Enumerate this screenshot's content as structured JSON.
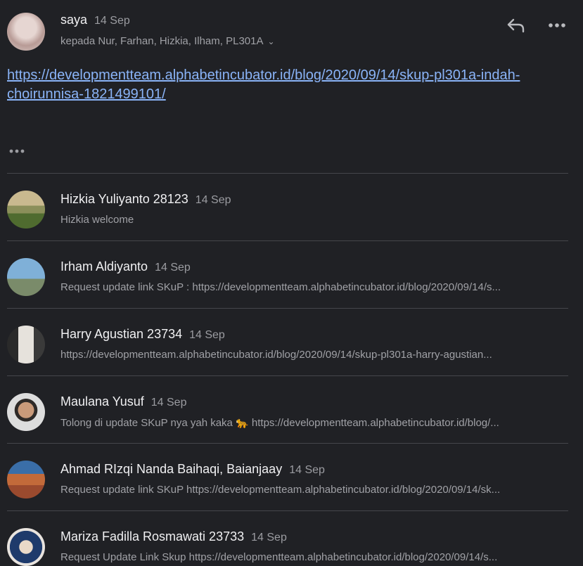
{
  "header": {
    "sender": "saya",
    "date": "14 Sep",
    "recipients": "kepada Nur, Farhan, Hizkia, Ilham, PL301A",
    "reply_icon": "reply-icon",
    "more_icon": "more-icon"
  },
  "message": {
    "link": "https://developmentteam.alphabetincubator.id/blog/2020/09/14/skup-pl301a-indah-choirunnisa-1821499101/"
  },
  "colors": {
    "background": "#202125",
    "link": "#8ab4f8",
    "divider": "#45464b"
  },
  "replies": [
    {
      "name": "Hizkia Yuliyanto 28123",
      "date": "14 Sep",
      "preview": "Hizkia welcome"
    },
    {
      "name": "Irham Aldiyanto",
      "date": "14 Sep",
      "preview": "Request update link SKuP : https://developmentteam.alphabetincubator.id/blog/2020/09/14/s..."
    },
    {
      "name": "Harry Agustian 23734",
      "date": "14 Sep",
      "preview": "https://developmentteam.alphabetincubator.id/blog/2020/09/14/skup-pl301a-harry-agustian..."
    },
    {
      "name": "Maulana Yusuf",
      "date": "14 Sep",
      "preview": "Tolong di update SKuP nya yah kaka 🐆 https://developmentteam.alphabetincubator.id/blog/..."
    },
    {
      "name": "Ahmad RIzqi Nanda Baihaqi, Baianjaay",
      "date": "14 Sep",
      "preview": "Request update link SKuP https://developmentteam.alphabetincubator.id/blog/2020/09/14/sk..."
    },
    {
      "name": "Mariza Fadilla Rosmawati 23733",
      "date": "14 Sep",
      "preview": "Request Update Link Skup https://developmentteam.alphabetincubator.id/blog/2020/09/14/s..."
    }
  ]
}
